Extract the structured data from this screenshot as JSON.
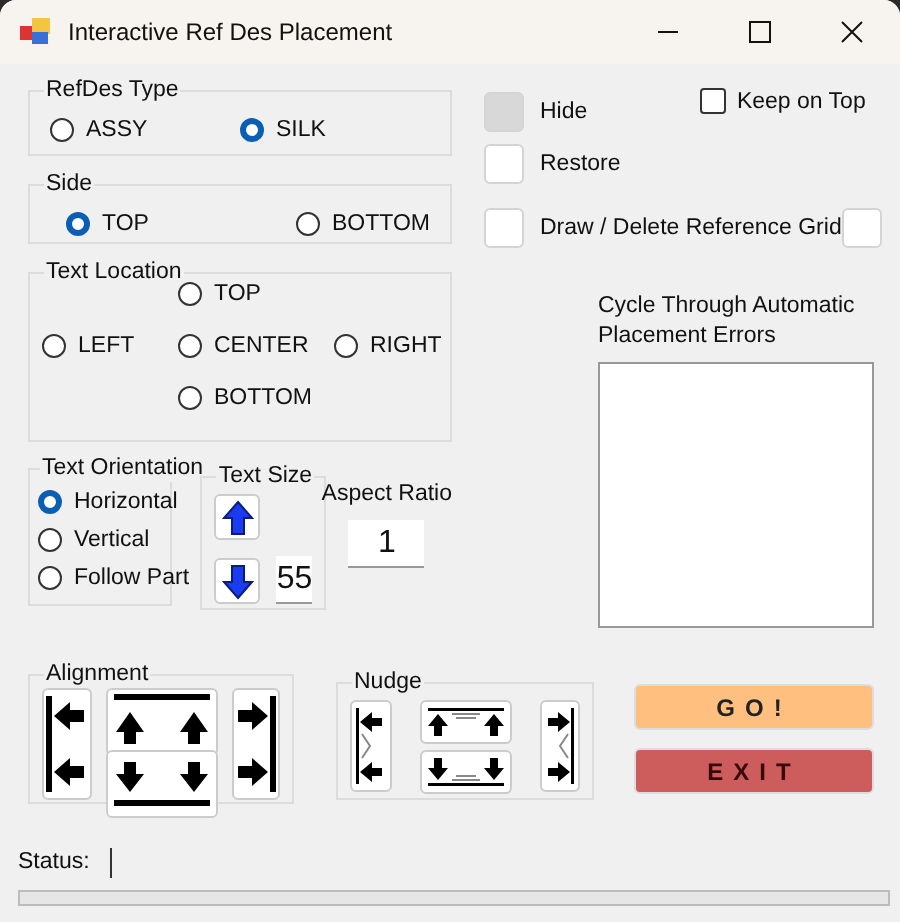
{
  "window": {
    "title": "Interactive Ref Des Placement"
  },
  "refdes_type": {
    "label": "RefDes Type",
    "options": [
      {
        "label": "ASSY",
        "selected": false
      },
      {
        "label": "SILK",
        "selected": true
      }
    ]
  },
  "side": {
    "label": "Side",
    "options": [
      {
        "label": "TOP",
        "selected": true
      },
      {
        "label": "BOTTOM",
        "selected": false
      }
    ]
  },
  "text_location": {
    "label": "Text Location",
    "options": [
      {
        "label": "TOP",
        "selected": false
      },
      {
        "label": "LEFT",
        "selected": false
      },
      {
        "label": "CENTER",
        "selected": false
      },
      {
        "label": "RIGHT",
        "selected": false
      },
      {
        "label": "BOTTOM",
        "selected": false
      }
    ]
  },
  "text_orientation": {
    "label": "Text Orientation",
    "options": [
      {
        "label": "Horizontal",
        "selected": true
      },
      {
        "label": "Vertical",
        "selected": false
      },
      {
        "label": "Follow Part",
        "selected": false
      }
    ]
  },
  "text_size": {
    "label": "Text Size",
    "value": "55"
  },
  "aspect_ratio": {
    "label": "Aspect Ratio",
    "value": "1"
  },
  "hide": {
    "label": "Hide",
    "checked": false,
    "disabled": true
  },
  "keep_on_top": {
    "label": "Keep  on Top",
    "checked": false
  },
  "restore": {
    "label": "Restore",
    "checked": false
  },
  "reference_grid": {
    "label": "Draw / Delete Reference Grid",
    "checked": false,
    "extra_checked": false
  },
  "cycle_errors": {
    "label": "Cycle Through Automatic Placement Errors"
  },
  "alignment": {
    "label": "Alignment"
  },
  "nudge": {
    "label": "Nudge"
  },
  "buttons": [
    {
      "label": "GO!",
      "kind": "go"
    },
    {
      "label": "EXIT",
      "kind": "exit"
    }
  ],
  "status": {
    "label": "Status:",
    "level": 0
  }
}
